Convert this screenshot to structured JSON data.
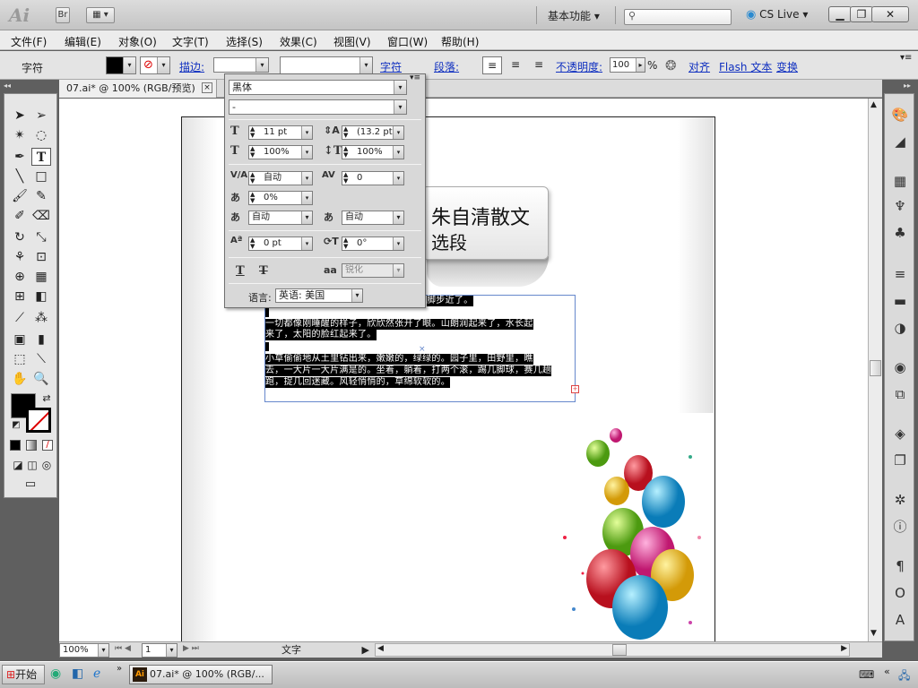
{
  "titlebar": {
    "logo": "Ai",
    "bridge_label": "Br",
    "workspace_label": "基本功能",
    "cslive_label": "CS Live"
  },
  "menu": [
    "文件(F)",
    "编辑(E)",
    "对象(O)",
    "文字(T)",
    "选择(S)",
    "效果(C)",
    "视图(V)",
    "窗口(W)",
    "帮助(H)"
  ],
  "control_bar": {
    "tool_label": "字符",
    "stroke_label": "描边:",
    "char_link": "字符",
    "para_label": "段落:",
    "opacity_label": "不透明度:",
    "opacity_value": "100",
    "opacity_unit": "%",
    "align_link": "对齐",
    "flash_link": "Flash 文本",
    "transform_link": "变换"
  },
  "document_tab": {
    "title": "07.ai* @ 100% (RGB/预览)",
    "close": "×"
  },
  "character_panel": {
    "font_family": "黑体",
    "font_style": "-",
    "font_size": "11 pt",
    "leading": "(13.2 pt)",
    "horizontal_scale": "100%",
    "vertical_scale": "100%",
    "kerning": "自动",
    "tracking": "0",
    "tsume": "0%",
    "insert_left": "自动",
    "insert_right": "自动",
    "baseline_shift": "0 pt",
    "rotation": "0°",
    "antialias": "锐化",
    "language_label": "语言:",
    "language_value": "英语: 美国"
  },
  "canvas": {
    "bubble_line1": "朱自清散文",
    "bubble_line2": "选段",
    "text_lines": [
      "                                              脚步近了。",
      "",
      "    一切都像刚睡醒的样子，欣欣然张开了眼。山朗润起来了，水长起",
      "来了，太阳的脸红起来了。",
      "",
      "    小草偷偷地从土里钻出来，嫩嫩的，绿绿的。园子里，田野里，瞧",
      "去，一大片一大片满是的。坐着，躺着，打两个滚，踢几脚球，赛几趟",
      "跑，捉几回迷藏。风轻悄悄的，草绵软软的。"
    ]
  },
  "status_bar": {
    "zoom": "100%",
    "page": "1",
    "status_text": "文字"
  },
  "taskbar": {
    "start_label": "开始",
    "task_label": "07.ai* @ 100% (RGB/..."
  },
  "colors": {
    "accent_link": "#1030c0",
    "selection_bg": "#000000",
    "frame_border": "#6688cc"
  }
}
